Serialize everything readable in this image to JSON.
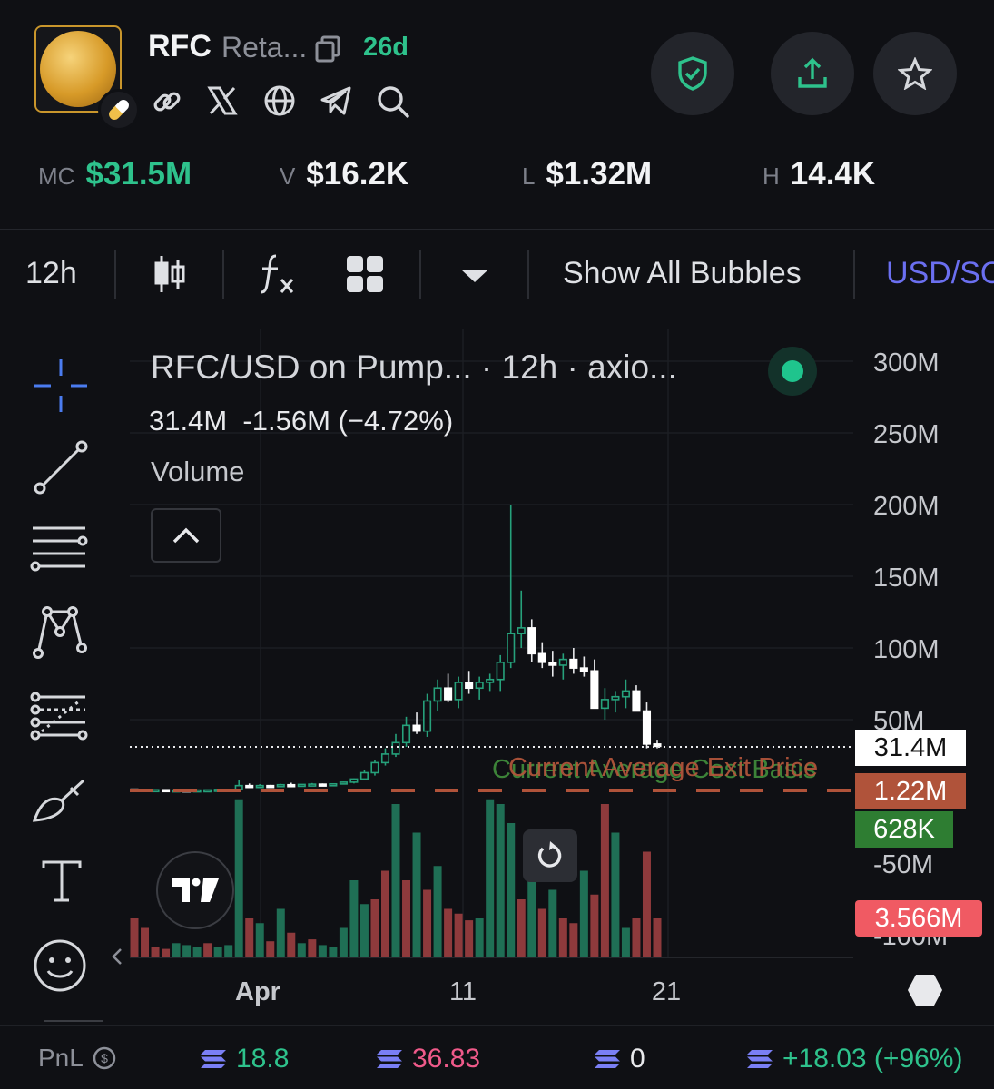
{
  "token": {
    "ticker": "RFC",
    "name": "Reta...",
    "age": "26d"
  },
  "stats": [
    {
      "label": "MC",
      "value": "$31.5M",
      "accent": "#2ec28c"
    },
    {
      "label": "V",
      "value": "$16.2K",
      "accent": "#f2f3f5"
    },
    {
      "label": "L",
      "value": "$1.32M",
      "accent": "#f2f3f5"
    },
    {
      "label": "H",
      "value": "14.4K",
      "accent": "#f2f3f5"
    }
  ],
  "toolbar": {
    "interval": "12h",
    "bubbles": "Show All Bubbles",
    "currency": "USD/SOL"
  },
  "legend": {
    "title": "RFC/USD on Pump...  · 12h · axio...",
    "ohlc_close": "31.4M",
    "ohlc_change": "-1.56M (−4.72%)",
    "volume_label": "Volume"
  },
  "axis": {
    "y_ticks": [
      "300M",
      "250M",
      "200M",
      "150M",
      "100M",
      "50M",
      "-50M",
      "-100M"
    ],
    "x_ticks": [
      "Apr",
      "11",
      "21"
    ]
  },
  "overlay": {
    "avg_exit_label": "Current Average Exit Price",
    "cost_basis_label": "Current Average Cost Basis"
  },
  "price_tags": [
    {
      "value": "31.4M",
      "bg": "#ffffff",
      "fg": "#111111"
    },
    {
      "value": "1.22M",
      "bg": "#b0533a",
      "fg": "#ffffff"
    },
    {
      "value": "628K",
      "bg": "#2e7d32",
      "fg": "#ffffff"
    },
    {
      "value": "3.566M",
      "bg": "#f05a63",
      "fg": "#ffffff"
    }
  ],
  "footer": {
    "pnl_label": "PnL",
    "bought": "18.8",
    "sold": "36.83",
    "holding": "0",
    "pnl": "+18.03 (+96%)"
  },
  "chart_data": {
    "type": "candlestick",
    "interval": "12h",
    "ylim": [
      -100,
      300
    ],
    "y_unit": "M",
    "candles": [
      [
        1.5,
        1.8,
        1.0,
        1.2
      ],
      [
        1.2,
        1.6,
        0.9,
        1.0
      ],
      [
        1.0,
        1.3,
        0.8,
        1.1
      ],
      [
        1.1,
        1.2,
        0.7,
        0.8
      ],
      [
        0.8,
        1.1,
        0.6,
        0.9
      ],
      [
        0.9,
        1.0,
        0.6,
        0.7
      ],
      [
        0.7,
        1.0,
        0.5,
        0.9
      ],
      [
        0.9,
        1.2,
        0.7,
        1.0
      ],
      [
        1.0,
        1.4,
        0.8,
        1.3
      ],
      [
        1.3,
        1.6,
        1.0,
        1.2
      ],
      [
        1.2,
        8.0,
        1.1,
        4.0
      ],
      [
        4.0,
        5.5,
        2.8,
        3.5
      ],
      [
        3.5,
        5.0,
        3.0,
        4.0
      ],
      [
        4.0,
        4.5,
        3.2,
        3.8
      ],
      [
        3.8,
        5.2,
        3.5,
        4.6
      ],
      [
        4.6,
        6.0,
        3.8,
        4.2
      ],
      [
        4.2,
        5.0,
        3.6,
        4.8
      ],
      [
        4.8,
        5.8,
        4.0,
        5.0
      ],
      [
        5.0,
        5.5,
        3.8,
        4.4
      ],
      [
        4.4,
        5.6,
        4.0,
        5.2
      ],
      [
        5.2,
        6.8,
        4.8,
        6.4
      ],
      [
        6.4,
        9.0,
        5.5,
        8.6
      ],
      [
        8.6,
        15,
        7.8,
        13
      ],
      [
        13,
        22,
        11,
        20
      ],
      [
        20,
        30,
        18,
        26
      ],
      [
        26,
        40,
        24,
        34
      ],
      [
        34,
        52,
        31,
        46
      ],
      [
        46,
        55,
        40,
        42
      ],
      [
        42,
        68,
        38,
        63
      ],
      [
        63,
        78,
        56,
        72
      ],
      [
        72,
        82,
        62,
        64
      ],
      [
        64,
        80,
        58,
        76
      ],
      [
        76,
        84,
        68,
        72
      ],
      [
        72,
        80,
        64,
        76
      ],
      [
        76,
        82,
        70,
        78
      ],
      [
        78,
        95,
        70,
        90
      ],
      [
        90,
        200,
        86,
        110
      ],
      [
        110,
        140,
        100,
        114
      ],
      [
        114,
        120,
        90,
        96
      ],
      [
        96,
        104,
        86,
        90
      ],
      [
        90,
        98,
        80,
        88
      ],
      [
        88,
        96,
        78,
        92
      ],
      [
        92,
        100,
        82,
        86
      ],
      [
        86,
        94,
        80,
        84
      ],
      [
        84,
        92,
        60,
        58
      ],
      [
        58,
        72,
        50,
        64
      ],
      [
        64,
        70,
        55,
        66
      ],
      [
        66,
        78,
        58,
        70
      ],
      [
        70,
        74,
        60,
        56
      ],
      [
        56,
        62,
        30,
        33
      ],
      [
        33,
        36,
        30,
        31.4
      ]
    ],
    "volume": [
      [
        40,
        "red"
      ],
      [
        30,
        "red"
      ],
      [
        10,
        "red"
      ],
      [
        8,
        "red"
      ],
      [
        14,
        "green"
      ],
      [
        12,
        "green"
      ],
      [
        10,
        "green"
      ],
      [
        14,
        "red"
      ],
      [
        10,
        "green"
      ],
      [
        12,
        "green"
      ],
      [
        165,
        "green"
      ],
      [
        40,
        "red"
      ],
      [
        35,
        "green"
      ],
      [
        16,
        "red"
      ],
      [
        50,
        "green"
      ],
      [
        25,
        "red"
      ],
      [
        14,
        "green"
      ],
      [
        18,
        "red"
      ],
      [
        12,
        "green"
      ],
      [
        10,
        "green"
      ],
      [
        30,
        "green"
      ],
      [
        80,
        "green"
      ],
      [
        55,
        "green"
      ],
      [
        60,
        "red"
      ],
      [
        90,
        "red"
      ],
      [
        160,
        "green"
      ],
      [
        80,
        "red"
      ],
      [
        130,
        "green"
      ],
      [
        70,
        "red"
      ],
      [
        95,
        "green"
      ],
      [
        50,
        "red"
      ],
      [
        45,
        "red"
      ],
      [
        38,
        "red"
      ],
      [
        40,
        "green"
      ],
      [
        165,
        "green"
      ],
      [
        160,
        "green"
      ],
      [
        140,
        "green"
      ],
      [
        60,
        "red"
      ],
      [
        110,
        "green"
      ],
      [
        50,
        "red"
      ],
      [
        70,
        "green"
      ],
      [
        40,
        "red"
      ],
      [
        35,
        "red"
      ],
      [
        90,
        "green"
      ],
      [
        65,
        "red"
      ],
      [
        160,
        "red"
      ],
      [
        130,
        "green"
      ],
      [
        30,
        "green"
      ],
      [
        40,
        "red"
      ],
      [
        110,
        "red"
      ],
      [
        40,
        "red"
      ]
    ]
  }
}
